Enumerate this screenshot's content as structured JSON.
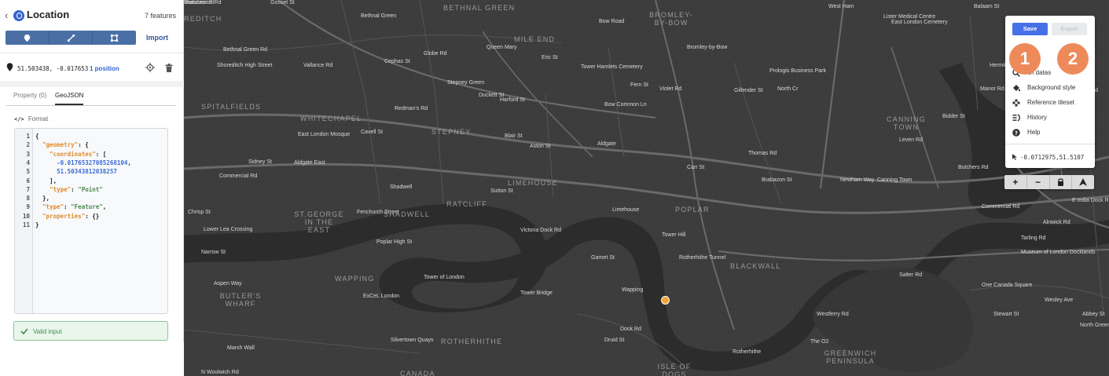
{
  "panel": {
    "back_icon": "chevron-left-icon",
    "title": "Location",
    "feature_count": "7 features",
    "import_label": "Import",
    "toolbar_icons": [
      "marker-icon",
      "line-icon",
      "polygon-icon"
    ],
    "position": {
      "coords": "51.503438, -0.017653",
      "link_label": "1 position"
    },
    "tabs": [
      {
        "label": "Property (0)",
        "active": false
      },
      {
        "label": "GeoJSON",
        "active": true
      }
    ],
    "format_label": "Format",
    "format_icon": "code-brackets-icon",
    "valid_label": "Valid input"
  },
  "menu": {
    "save_label": "Save",
    "export_label": "Export",
    "badge_1": "1",
    "badge_2": "2",
    "items": [
      {
        "label": "Search dataset",
        "icon": "search-dataset-icon"
      },
      {
        "label": "Background style",
        "icon": "paint-bucket-icon"
      },
      {
        "label": "Reference tileset",
        "icon": "tileset-icon"
      },
      {
        "label": "History",
        "icon": "history-icon"
      },
      {
        "label": "Help",
        "icon": "help-icon"
      }
    ],
    "visible_partial_label": "ch datas",
    "cursor_coords": "-0.0712975,51.5107"
  },
  "map": {
    "districts": [
      "BETHNAL GREEN",
      "MILE END",
      "BROMLEY-BY-BOW",
      "SPITALFIELDS",
      "WHITECHAPEL",
      "STEPNEY",
      "CANNING TOWN",
      "LIMEHOUSE",
      "RATCLIFF",
      "POPLAR",
      "ST.GEORGE IN THE EAST",
      "SHADWELL",
      "WAPPING",
      "BUTLER'S WHARF",
      "ROTHERHITHE",
      "BLACKWALL",
      "GREENWICH PENINSULA",
      "ISLE OF DOGS",
      "CANADA",
      "REDITCH"
    ],
    "streets": [
      "Gosset St",
      "Bethnal Green",
      "Bethnal Green Rd",
      "Shoreditch High Street",
      "Vallance Rd",
      "Cephas St",
      "Globe Rd",
      "Queen Mary",
      "Eric St",
      "Bow Road",
      "Bromley-by-Bow",
      "West Ham",
      "Lister Medical Centre",
      "East London Cemetery",
      "Balaam St",
      "Tower Hamlets Cemetery",
      "Fern St",
      "Violet Rd",
      "Gillender St",
      "Prologis Business Park",
      "North Cr",
      "Hermit Rd",
      "Croydon Rd",
      "Avenons Rd",
      "Stepney Green",
      "Redman's Rd",
      "Duckett St",
      "Harford St",
      "Bow Common Ln",
      "Manor Rd",
      "Bidder St",
      "Cavell St",
      "East London Mosque",
      "Sidney St",
      "Aldgate East",
      "Commercial Rd",
      "Aldgate",
      "Thomas Rd",
      "Leven Rd",
      "Newham Way",
      "Canning Town",
      "Butchers Rd",
      "Brabazon St",
      "Blair St",
      "Aston St",
      "Carr St",
      "Chrisp St",
      "Fenchurch Street",
      "Shadwell",
      "Sutton St",
      "Limehouse",
      "Commercial Rd",
      "E India Dock Rd",
      "Tarling Rd",
      "Alnwick Rd",
      "Lower Lea Crossing",
      "Victoria Dock Rd",
      "Tower Hill",
      "Narrow St",
      "Poplar High St",
      "Tower of London",
      "Garnet St",
      "Rotherhithe Tunnel",
      "Museum of London Docklands",
      "Aspen Way",
      "ExCeL London",
      "Tower Bridge",
      "Wapping",
      "Salter Rd",
      "One Canada Square",
      "Dock Rd",
      "Wesley Ave",
      "Marsh Wall",
      "Silvertown Quays",
      "Druid St",
      "Rotherhithe",
      "Westferry Rd",
      "Stewart St",
      "The O2",
      "N Woolwich Rd",
      "North Greenwich",
      "Abbey St",
      "Brabazon St",
      "Manchester Rd"
    ],
    "marker_label": "selected-point"
  },
  "zoom": {
    "zoom_in": "+",
    "zoom_out": "−",
    "lock_icon": "lock-icon",
    "north_icon": "north-arrow-icon"
  },
  "colors": {
    "accent": "#4670e8",
    "badge": "#ee8a5a",
    "marker": "#f3a53a",
    "map_bg": "#3d3d3d",
    "valid_green": "#3d8b4f"
  }
}
